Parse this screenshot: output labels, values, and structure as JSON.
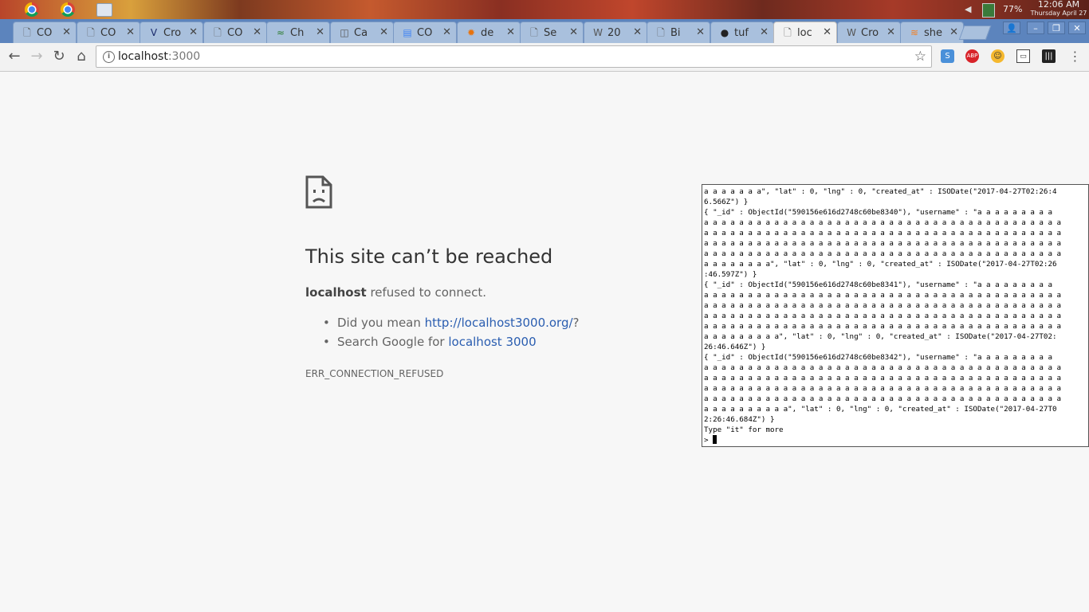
{
  "desktop": {
    "battery_percent": "77%",
    "clock_time": "12:06 AM",
    "clock_date": "Thursday April 27"
  },
  "tabs": [
    {
      "title": "CO",
      "icon": "page-icon"
    },
    {
      "title": "CO",
      "icon": "page-icon"
    },
    {
      "title": "Cro",
      "icon": "v-logo-icon"
    },
    {
      "title": "CO",
      "icon": "page-icon"
    },
    {
      "title": "Ch",
      "icon": "chart-icon"
    },
    {
      "title": "Ca",
      "icon": "dictionary-icon"
    },
    {
      "title": "CO",
      "icon": "google-docs-icon"
    },
    {
      "title": "de",
      "icon": "gear-icon"
    },
    {
      "title": "Se",
      "icon": "page-icon"
    },
    {
      "title": "20",
      "icon": "wikipedia-icon"
    },
    {
      "title": "Bi",
      "icon": "page-icon"
    },
    {
      "title": "tuf",
      "icon": "github-icon"
    },
    {
      "title": "loc",
      "icon": "page-icon",
      "active": true
    },
    {
      "title": "Cro",
      "icon": "wikipedia-icon"
    },
    {
      "title": "she",
      "icon": "stack-icon"
    }
  ],
  "omnibox": {
    "host": "localhost",
    "port": ":3000"
  },
  "error_page": {
    "title": "This site can’t be reached",
    "host_bold": "localhost",
    "message": " refused to connect.",
    "suggestion1_prefix": "Did you mean ",
    "suggestion1_link": "http://localhost3000.org/",
    "suggestion1_suffix": "?",
    "suggestion2_prefix": "Search Google for ",
    "suggestion2_link": "localhost 3000",
    "error_code": "ERR_CONNECTION_REFUSED"
  },
  "terminal": {
    "output": "a a a a a a a\", \"lat\" : 0, \"lng\" : 0, \"created_at\" : ISODate(\"2017-04-27T02:26:4\n6.566Z\") }\n{ \"_id\" : ObjectId(\"590156e616d2748c60be8340\"), \"username\" : \"a a a a a a a a a\na a a a a a a a a a a a a a a a a a a a a a a a a a a a a a a a a a a a a a a a a\na a a a a a a a a a a a a a a a a a a a a a a a a a a a a a a a a a a a a a a a a\na a a a a a a a a a a a a a a a a a a a a a a a a a a a a a a a a a a a a a a a a\na a a a a a a a a a a a a a a a a a a a a a a a a a a a a a a a a a a a a a a a a\na a a a a a a a\", \"lat\" : 0, \"lng\" : 0, \"created_at\" : ISODate(\"2017-04-27T02:26\n:46.597Z\") }\n{ \"_id\" : ObjectId(\"590156e616d2748c60be8341\"), \"username\" : \"a a a a a a a a a\na a a a a a a a a a a a a a a a a a a a a a a a a a a a a a a a a a a a a a a a a\na a a a a a a a a a a a a a a a a a a a a a a a a a a a a a a a a a a a a a a a a\na a a a a a a a a a a a a a a a a a a a a a a a a a a a a a a a a a a a a a a a a\na a a a a a a a a a a a a a a a a a a a a a a a a a a a a a a a a a a a a a a a a\na a a a a a a a a\", \"lat\" : 0, \"lng\" : 0, \"created_at\" : ISODate(\"2017-04-27T02:\n26:46.646Z\") }\n{ \"_id\" : ObjectId(\"590156e616d2748c60be8342\"), \"username\" : \"a a a a a a a a a\na a a a a a a a a a a a a a a a a a a a a a a a a a a a a a a a a a a a a a a a a\na a a a a a a a a a a a a a a a a a a a a a a a a a a a a a a a a a a a a a a a a\na a a a a a a a a a a a a a a a a a a a a a a a a a a a a a a a a a a a a a a a a\na a a a a a a a a a a a a a a a a a a a a a a a a a a a a a a a a a a a a a a a a\na a a a a a a a a a\", \"lat\" : 0, \"lng\" : 0, \"created_at\" : ISODate(\"2017-04-27T0\n2:26:46.684Z\") }\nType \"it\" for more",
    "prompt": "> "
  }
}
